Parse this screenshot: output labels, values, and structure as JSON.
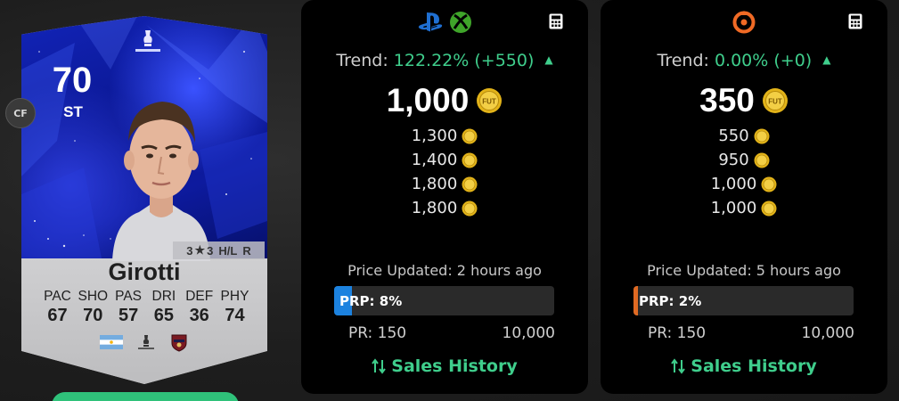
{
  "card": {
    "rating": "70",
    "position": "ST",
    "alt_position": "CF",
    "name": "Girotti",
    "skills": "3",
    "weak_foot": "3",
    "work_rates": "H/L",
    "foot": "R",
    "stat_labels": [
      "PAC",
      "SHO",
      "PAS",
      "DRI",
      "DEF",
      "PHY"
    ],
    "stat_values": [
      "67",
      "70",
      "57",
      "65",
      "36",
      "74"
    ],
    "nation_icon": "argentina-flag-icon",
    "league_icon": "league-crest-icon",
    "club_icon": "club-crest-icon",
    "card_color": "#0d1a9e"
  },
  "panels": [
    {
      "platform_icons": [
        "playstation-icon",
        "xbox-icon"
      ],
      "trend_label": "Trend:",
      "trend_value": "122.22% (+550)",
      "main_price": "1,000",
      "prices": [
        "1,300",
        "1,400",
        "1,800",
        "1,800"
      ],
      "updated": "Price Updated: 2 hours ago",
      "prp": "PRP: 8%",
      "prp_fraction": 0.08,
      "pr_min": "PR: 150",
      "pr_max": "10,000",
      "sales_label": "Sales History",
      "accent": "#1c82df"
    },
    {
      "platform_icons": [
        "origin-icon"
      ],
      "trend_label": "Trend:",
      "trend_value": "0.00% (+0)",
      "main_price": "350",
      "prices": [
        "550",
        "950",
        "1,000",
        "1,000"
      ],
      "updated": "Price Updated: 5 hours ago",
      "prp": "PRP: 2%",
      "prp_fraction": 0.02,
      "pr_min": "PR: 150",
      "pr_max": "10,000",
      "sales_label": "Sales History",
      "accent": "#e06a23"
    }
  ],
  "colors": {
    "trend_green": "#3fce8c",
    "coin_gold": "#e2b319",
    "panel_bg": "#000000"
  }
}
